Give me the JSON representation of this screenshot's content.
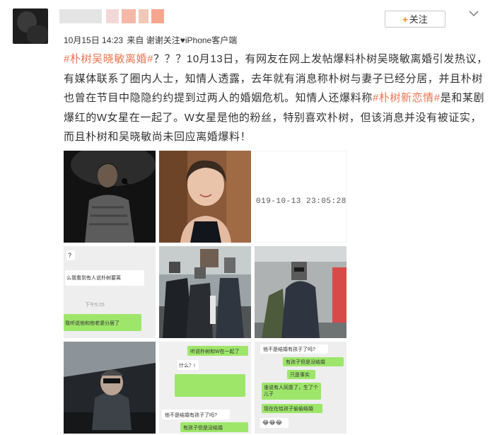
{
  "post": {
    "meta": {
      "date": "10月15日 14:23",
      "via": "来自 谢谢关注♥iPhone客户端"
    },
    "follow_label": "关注",
    "content": {
      "tag1": "#朴树吴晓敏离婚#",
      "text1": "？？？10月13日，有网友在网上发帖爆料朴树吴晓敏离婚引发热议，有媒体联系了圈内人士，知情人透露，去年就有消息称朴树与妻子已经分居，并且朴树也曾在节目中隐隐约约提到过两人的婚姻危机。知情人还爆料称",
      "tag2": "#朴树新恋情#",
      "text2": "是和某剧爆红的W女星在一起了。W女星是他的粉丝，特别喜欢朴树，但该消息并没有被证实，而且朴树和吴晓敏尚未回应离婚爆料！"
    }
  },
  "images": {
    "timestamp_text": "019-10-13 23:05:28",
    "chat4": {
      "q": "?",
      "line1": "么我看到有人说朴树要离",
      "time": "下午5:25",
      "line2": "我听说他和他老婆分居了"
    },
    "chat8": {
      "line1": "听说朴树和W在一起了",
      "line2": "什么？!",
      "line3": "他不是结婚有孩子了吗?",
      "line4": "有孩子但是没结婚"
    },
    "chat9": {
      "line1": "他不是结婚有孩子了吗?",
      "line2": "有孩子但是没结婚",
      "line3": "只是事实",
      "line4": "谁说有人同意了，生了个儿子",
      "line5": "现在在给孩子偷偷结婚",
      "line6": "😂😂😂"
    }
  },
  "colors": {
    "accent": "#eb7350",
    "follow_plus": "#ff8200",
    "chat_green": "#9ee66a"
  }
}
